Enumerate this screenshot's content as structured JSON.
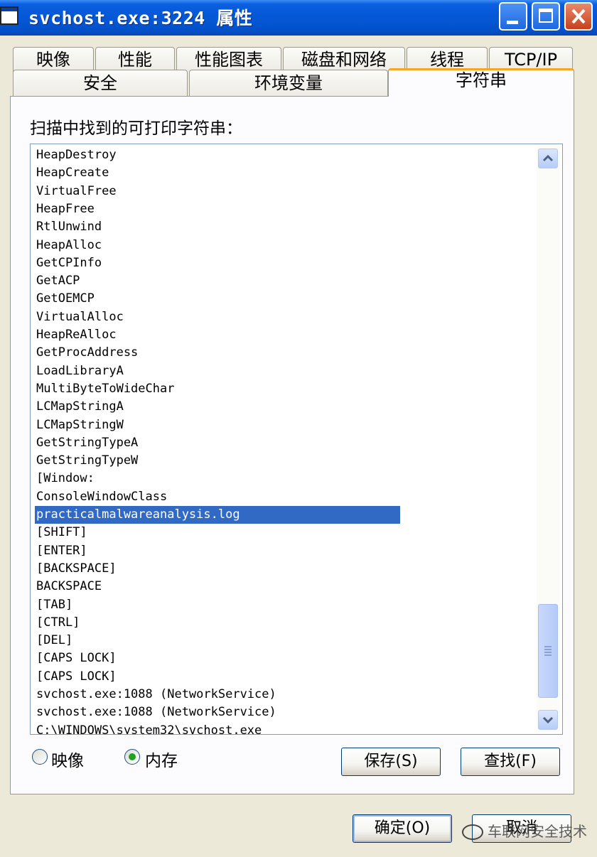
{
  "window": {
    "title": "svchost.exe:3224 属性"
  },
  "tabs_row1": [
    "映像",
    "性能",
    "性能图表",
    "磁盘和网络",
    "线程",
    "TCP/IP"
  ],
  "tabs_row2": [
    "安全",
    "环境变量",
    "字符串"
  ],
  "active_tab": "字符串",
  "scan_label": "扫描中找到的可打印字符串：",
  "strings": [
    "HeapDestroy",
    "HeapCreate",
    "VirtualFree",
    "HeapFree",
    "RtlUnwind",
    "HeapAlloc",
    "GetCPInfo",
    "GetACP",
    "GetOEMCP",
    "VirtualAlloc",
    "HeapReAlloc",
    "GetProcAddress",
    "LoadLibraryA",
    "MultiByteToWideChar",
    "LCMapStringA",
    "LCMapStringW",
    "GetStringTypeA",
    "GetStringTypeW",
    "[Window:",
    "ConsoleWindowClass",
    "practicalmalwareanalysis.log",
    "[SHIFT]",
    "[ENTER]",
    "[BACKSPACE]",
    "BACKSPACE",
    "[TAB]",
    "[CTRL]",
    "[DEL]",
    "[CAPS LOCK]",
    "[CAPS LOCK]",
    "svchost.exe:1088 (NetworkService)",
    "svchost.exe:1088 (NetworkService)",
    "C:\\WINDOWS\\system32\\svchost.exe"
  ],
  "selected_string": "practicalmalwareanalysis.log",
  "radio_image_label": "映像",
  "radio_memory_label": "内存",
  "selected_radio": "内存",
  "save_label": "保存(S)",
  "find_label": "查找(F)",
  "ok_label": "确定(O)",
  "cancel_label": "取消",
  "watermark_text": "车联网安全技术"
}
